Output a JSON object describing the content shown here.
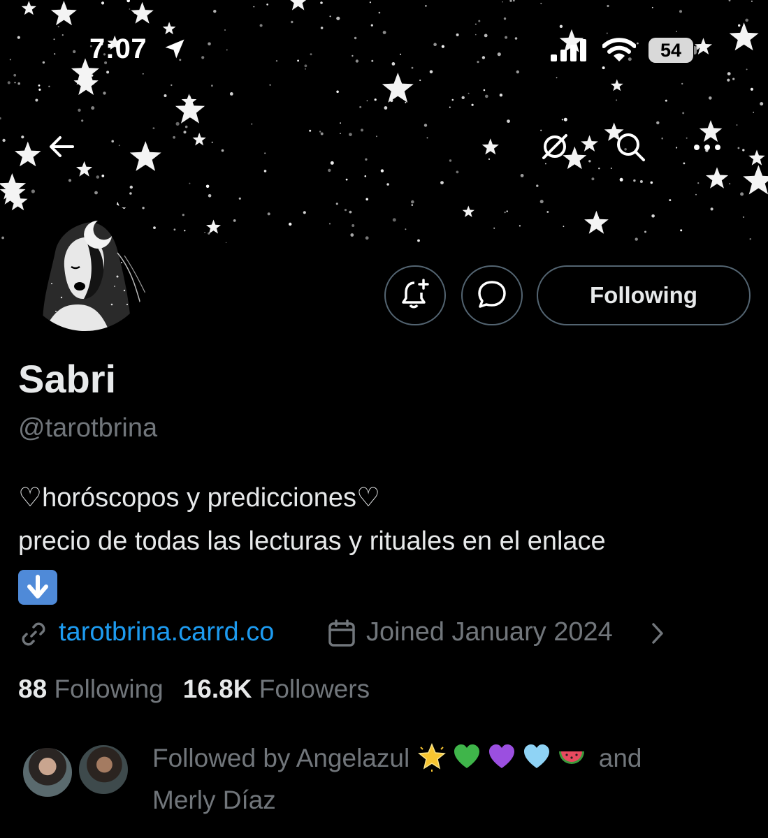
{
  "status_bar": {
    "time": "7:07",
    "battery": "54"
  },
  "header": {
    "icons": [
      "back-arrow-icon",
      "grok-icon",
      "search-icon",
      "more-icon"
    ]
  },
  "profile": {
    "display_name": "Sabri",
    "handle": "@tarotbrina",
    "bio_line1": "♡horóscopos y predicciones♡",
    "bio_line2": "precio de todas las lecturas y rituales en el enlace",
    "link": "tarotbrina.carrd.co",
    "joined": "Joined January 2024"
  },
  "actions": {
    "following_label": "Following"
  },
  "stats": {
    "following_count": "88",
    "following_label": "Following",
    "followers_count": "16.8K",
    "followers_label": "Followers"
  },
  "followed_by": {
    "prefix": "Followed by",
    "name1": "Angelazul",
    "and": "and",
    "name2": "Merly Díaz"
  },
  "colors": {
    "background": "#000000",
    "link": "#1d9bf0",
    "secondary_text": "#71767b",
    "primary_text": "#e7e9ea",
    "button_border": "#536471"
  }
}
